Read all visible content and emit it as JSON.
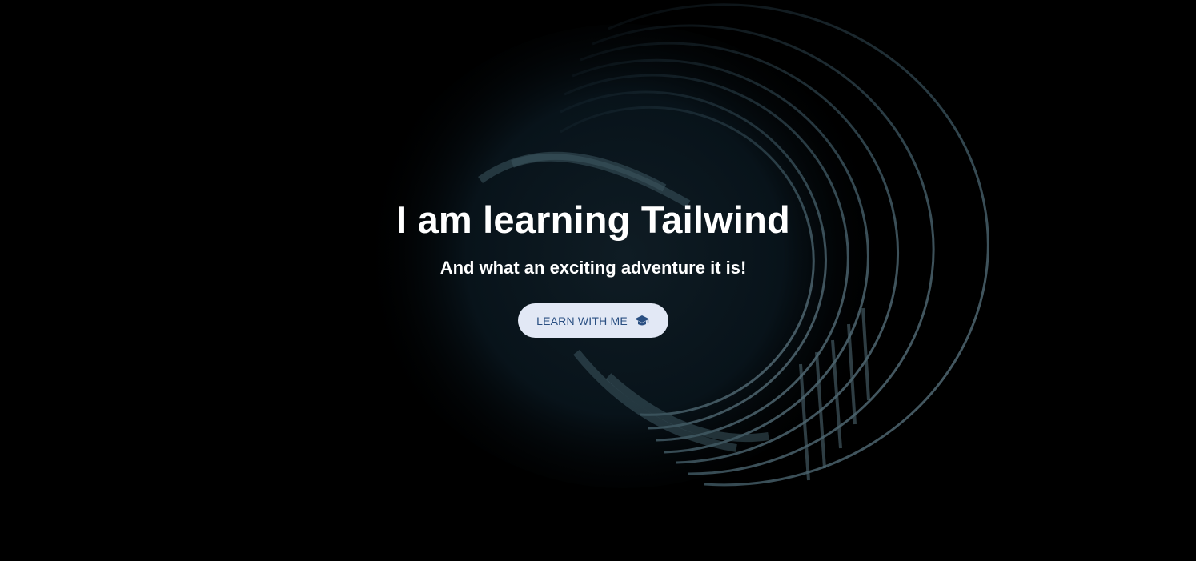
{
  "hero": {
    "title": "I am learning Tailwind",
    "subtitle": "And what an exciting adventure it is!",
    "cta": {
      "label": "LEARN WITH ME",
      "icon": "graduation-cap-icon"
    },
    "background_image": "dark-spiral-swirl"
  },
  "colors": {
    "background": "#000000",
    "text": "#ffffff",
    "button_bg": "#e2e8f5",
    "button_text": "#2a4f82"
  }
}
